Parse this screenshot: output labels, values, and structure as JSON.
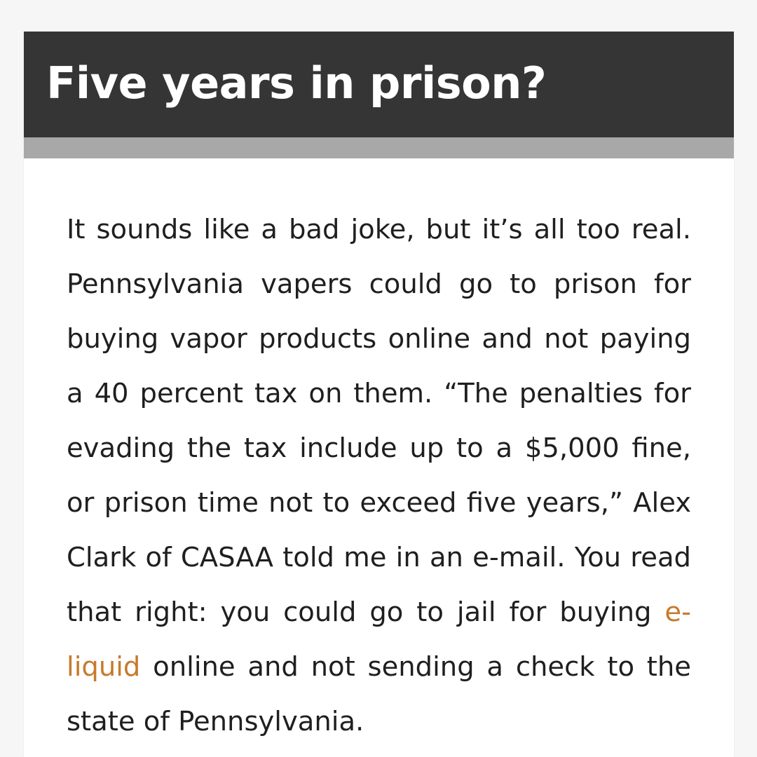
{
  "article": {
    "title": "Five years in prison?",
    "paragraph_before_link": "It sounds like a bad joke, but it’s all too real. Pennsylvania vapers could go to prison for buying vapor products online and not paying a 40 percent tax on them. “The penalties for evading the tax include up to a $5,000 fine, or prison time not to exceed five years,” Alex Clark of CASAA told me in an e-mail. You read that right: you could go to jail for buying ",
    "link_text": "e-liquid",
    "paragraph_after_link": " online and not sending a check to the state of Pennsylvania."
  },
  "colors": {
    "header_background": "#353535",
    "header_strip": "#a8a8a8",
    "title_text": "#ffffff",
    "body_text": "#1f1f1f",
    "link": "#c77a2a",
    "card_background": "#ffffff",
    "page_background": "#f6f6f6"
  }
}
